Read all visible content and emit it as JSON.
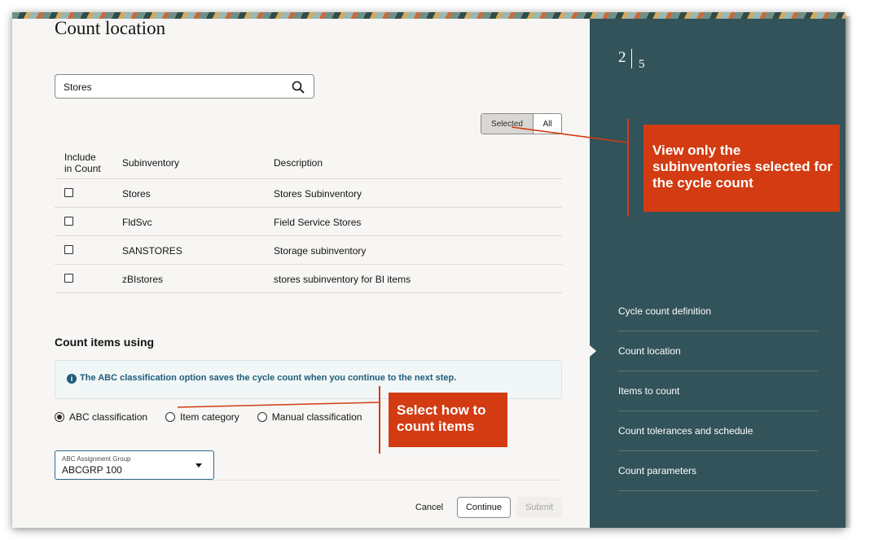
{
  "page": {
    "title": "Count location"
  },
  "search": {
    "value": "Stores"
  },
  "filter_toggle": {
    "selected_label": "Selected",
    "all_label": "All"
  },
  "table": {
    "headers": {
      "include_line1": "Include",
      "include_line2": "in Count",
      "subinventory": "Subinventory",
      "description": "Description"
    },
    "rows": [
      {
        "subinventory": "Stores",
        "description": "Stores Subinventory",
        "checked": false
      },
      {
        "subinventory": "FldSvc",
        "description": "Field Service Stores",
        "checked": false
      },
      {
        "subinventory": "SANSTORES",
        "description": "Storage subinventory",
        "checked": false
      },
      {
        "subinventory": "zBIstores",
        "description": "stores subinventory for BI items",
        "checked": false
      }
    ]
  },
  "count_items": {
    "title": "Count items using",
    "info": "The ABC classification option saves the cycle count when you continue to the next step.",
    "options": [
      {
        "label": "ABC classification",
        "checked": true
      },
      {
        "label": "Item category",
        "checked": false
      },
      {
        "label": "Manual classification",
        "checked": false
      }
    ],
    "select": {
      "label": "ABC Assignment Group",
      "value": "ABCGRP 100"
    }
  },
  "footer": {
    "cancel": "Cancel",
    "continue": "Continue",
    "submit": "Submit"
  },
  "steps": {
    "current": "2",
    "total": "5",
    "items": [
      "Cycle count definition",
      "Count location",
      "Items to count",
      "Count tolerances and schedule",
      "Count parameters"
    ],
    "active_index": 1
  },
  "callouts": {
    "view_selected": "View only the subinventories selected for the cycle count",
    "select_how": "Select how to count items"
  },
  "colors": {
    "panel": "#32535a",
    "callout": "#d33b12",
    "info_text": "#1f5c7a",
    "page_bg": "#f7f6f4"
  }
}
